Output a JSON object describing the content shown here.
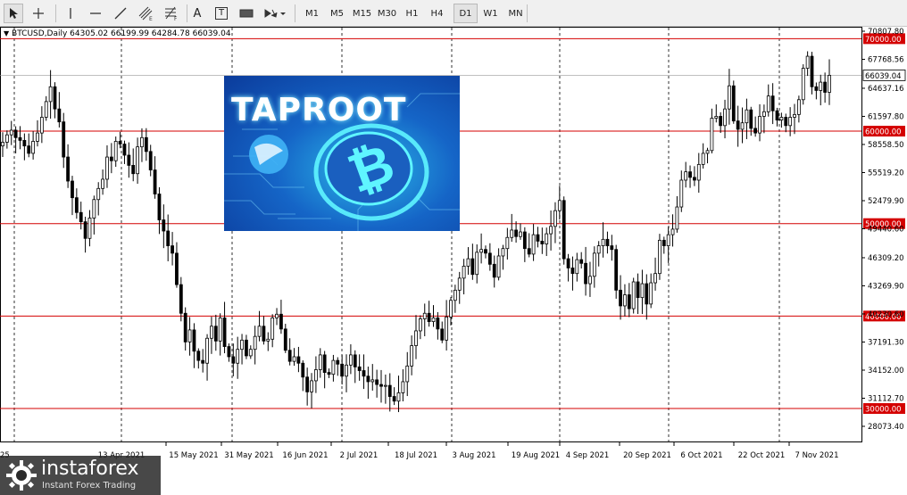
{
  "toolbar": {
    "timeframes": [
      "M1",
      "M5",
      "M15",
      "M30",
      "H1",
      "H4",
      "D1",
      "W1",
      "MN"
    ],
    "active_timeframe": "D1",
    "text_tool_label": "A",
    "label_tool_label": "T"
  },
  "chart": {
    "header": "BTCUSD,Daily  64305.02 66199.99 64284.78 66039.04",
    "symbol_arrow": "▼"
  },
  "banner": {
    "title": "TAPROOT"
  },
  "logo": {
    "name": "instaforex",
    "tagline": "Instant Forex Trading"
  },
  "chart_data": {
    "type": "candlestick",
    "symbol": "BTCUSD",
    "timeframe": "Daily",
    "ohlc_last": {
      "open": 64305.02,
      "high": 66199.99,
      "low": 64284.78,
      "close": 66039.04
    },
    "ylim": [
      28073.4,
      71000
    ],
    "y_ticks": [
      "70807.80",
      "67768.56",
      "64637.16",
      "61597.80",
      "58558.50",
      "55519.20",
      "52479.90",
      "49440.60",
      "46309.20",
      "43269.90",
      "40230.60",
      "37191.30",
      "34152.00",
      "31112.70",
      "28073.40"
    ],
    "current_price_label": "66039.04",
    "horizontal_levels": [
      "70000.00",
      "60000.00",
      "50000.00",
      "40000.00",
      "30000.00"
    ],
    "x_labels": [
      "15 May 2021",
      "31 May 2021",
      "16 Jun 2021",
      "2 Jul 2021",
      "18 Jul 2021",
      "3 Aug 2021",
      "19 Aug 2021",
      "4 Sep 2021",
      "20 Sep 2021",
      "6 Oct 2021",
      "22 Oct 2021",
      "7 Nov 2021"
    ],
    "x_labels_partial": [
      "25",
      "13 Apr 2021"
    ],
    "close_path": [
      58800,
      59600,
      60100,
      59300,
      59000,
      58400,
      57600,
      58900,
      59800,
      61500,
      63200,
      64800,
      62400,
      61000,
      57200,
      54600,
      52800,
      51200,
      50200,
      48400,
      50600,
      52600,
      53800,
      54800,
      57200,
      56800,
      58900,
      58600,
      57400,
      56300,
      55400,
      58300,
      59300,
      57800,
      55800,
      53200,
      50400,
      49200,
      47600,
      46800,
      43400,
      40300,
      37200,
      38500,
      36200,
      35200,
      34900,
      37600,
      38900,
      37300,
      39800,
      36700,
      35600,
      34900,
      36400,
      37400,
      35700,
      36400,
      37800,
      38900,
      37300,
      37500,
      39800,
      40200,
      38600,
      36300,
      35100,
      35600,
      34900,
      33400,
      31800,
      33000,
      34200,
      35800,
      33900,
      33700,
      35200,
      34800,
      33500,
      34700,
      35800,
      34500,
      34100,
      33500,
      32900,
      33100,
      32600,
      32400,
      32500,
      31300,
      30800,
      31700,
      32900,
      34600,
      36800,
      38400,
      39700,
      40300,
      39400,
      39800,
      38600,
      37400,
      39900,
      41700,
      42800,
      44100,
      45400,
      46200,
      44500,
      46900,
      47200,
      46800,
      45600,
      44200,
      46500,
      47300,
      48500,
      49300,
      48600,
      49100,
      47300,
      46700,
      48800,
      48100,
      47800,
      48900,
      49700,
      51400,
      52500,
      46200,
      45200,
      44600,
      46100,
      45700,
      43500,
      44300,
      46800,
      47600,
      48300,
      47600,
      47200,
      42800,
      41100,
      42300,
      40800,
      43700,
      42000,
      43500,
      41300,
      43600,
      44600,
      48200,
      47600,
      48800,
      49400,
      51800,
      54700,
      55600,
      55000,
      54700,
      56400,
      57600,
      57900,
      61400,
      61600,
      60600,
      62400,
      64900,
      61100,
      60200,
      60900,
      62300,
      60300,
      59800,
      61600,
      62100,
      63800,
      62200,
      61200,
      61500,
      60600,
      61500,
      61800,
      63400,
      66800,
      68100,
      64800,
      64400,
      65300,
      64200,
      66039
    ]
  }
}
